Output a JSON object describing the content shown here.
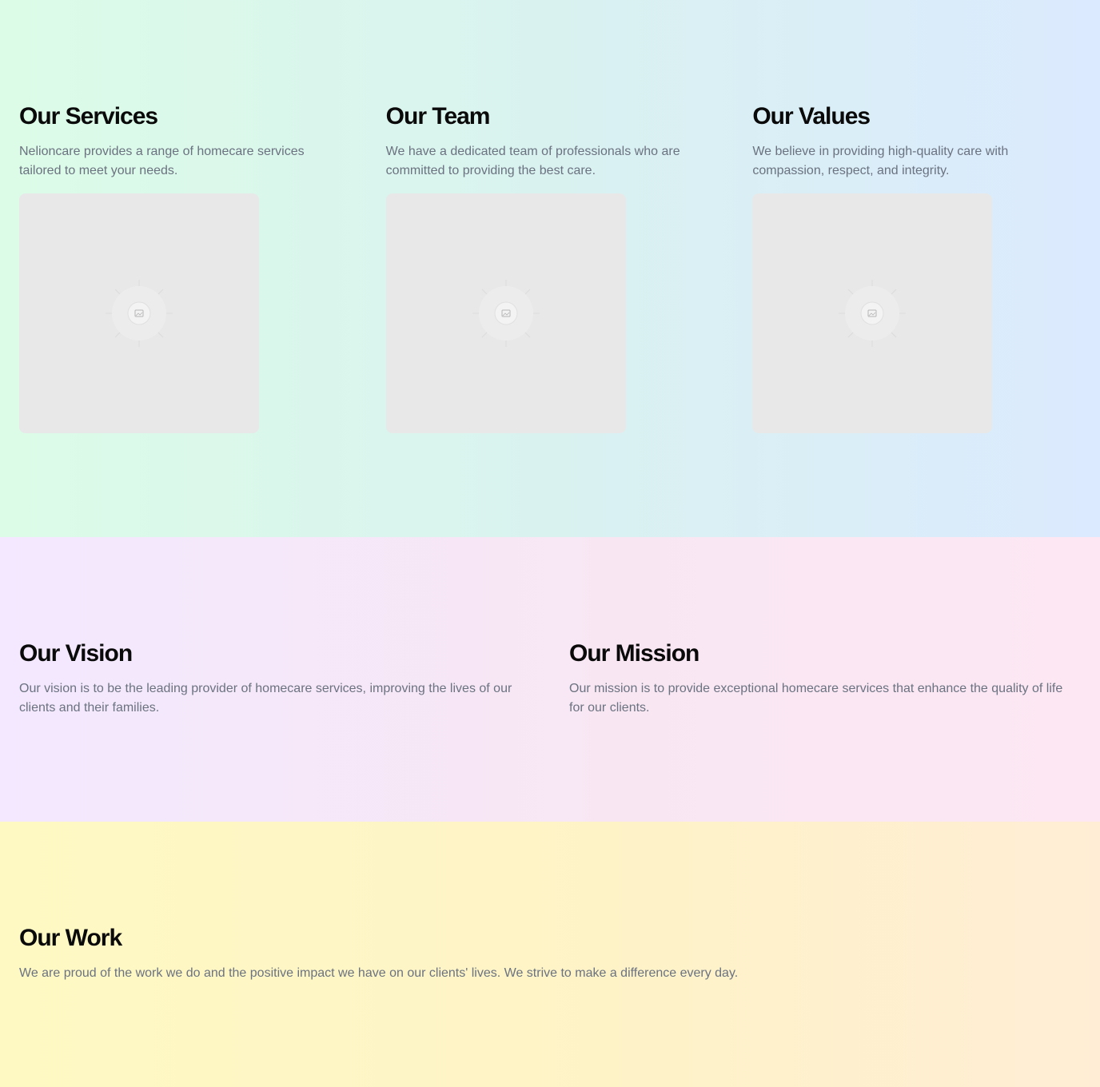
{
  "top": {
    "columns": [
      {
        "title": "Our Services",
        "text": "Nelioncare provides a range of homecare services tailored to meet your needs.",
        "image_icon": "image-placeholder-icon"
      },
      {
        "title": "Our Team",
        "text": "We have a dedicated team of professionals who are committed to providing the best care.",
        "image_icon": "image-placeholder-icon"
      },
      {
        "title": "Our Values",
        "text": "We believe in providing high-quality care with compassion, respect, and integrity.",
        "image_icon": "image-placeholder-icon"
      }
    ]
  },
  "middle": {
    "columns": [
      {
        "title": "Our Vision",
        "text": "Our vision is to be the leading provider of homecare services, improving the lives of our clients and their families."
      },
      {
        "title": "Our Mission",
        "text": "Our mission is to provide exceptional homecare services that enhance the quality of life for our clients."
      }
    ]
  },
  "bottom": {
    "title": "Our Work",
    "text": "We are proud of the work we do and the positive impact we have on our clients' lives. We strive to make a difference every day."
  },
  "colors": {
    "heading": "#0a0a0a",
    "body_text": "#6b7280",
    "placeholder_bg": "#e8e8e8"
  }
}
